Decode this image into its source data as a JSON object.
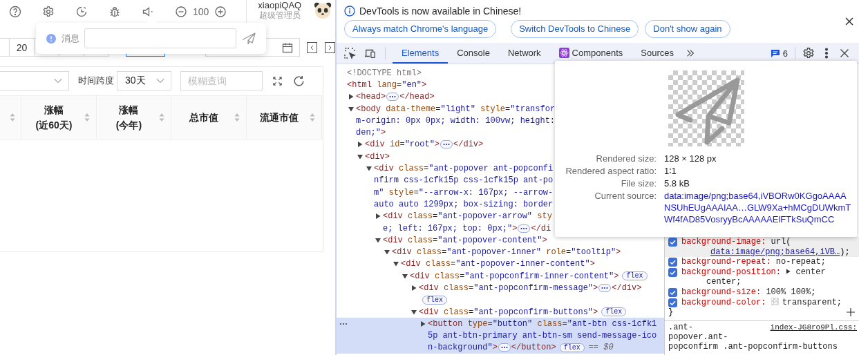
{
  "app": {
    "header": {
      "zoom": "100",
      "user_name": "xiaopiQAQ",
      "user_role": "超级管理员"
    },
    "message_popover": {
      "label": "消息"
    },
    "range_buttons": [
      {
        "selected": false
      },
      {
        "label": "20",
        "selected": false
      },
      {
        "selected": false
      },
      {
        "selected": false
      },
      {
        "selected": false
      },
      {
        "selected": true
      }
    ],
    "filters": {
      "span_label": "时间跨度",
      "span_value": "30天",
      "search_placeholder": "模糊查询"
    },
    "table": {
      "columns": [
        {
          "label": "涨幅\n(近60天)"
        },
        {
          "label": "涨幅\n(今年)"
        },
        {
          "label": "总市值"
        },
        {
          "label": "流通市值"
        }
      ]
    }
  },
  "devtools": {
    "infobar": {
      "message": "DevTools is now available in Chinese!",
      "buttons": [
        "Always match Chrome's language",
        "Switch DevTools to Chinese",
        "Don't show again"
      ]
    },
    "tabs": [
      {
        "label": "Elements",
        "selected": true,
        "kind": "plain"
      },
      {
        "label": "Console",
        "selected": false,
        "kind": "plain"
      },
      {
        "label": "Network",
        "selected": false,
        "kind": "plain"
      },
      {
        "label": "Components",
        "selected": false,
        "kind": "react"
      },
      {
        "label": "Sources",
        "selected": false,
        "kind": "plain"
      }
    ],
    "issues_count": "6",
    "elements": [
      {
        "kind": "doctype",
        "selected": false,
        "lines": [
          [
            "<!DOCTYPE html>"
          ]
        ]
      },
      {
        "kind": "element",
        "selected": false,
        "lines": [
          [
            "<html lang=\"en\">"
          ]
        ],
        "children": [
          {
            "kind": "element",
            "selected": false,
            "expanded": false,
            "lines": [
              [
                "<head>",
                {
                  "kind": "more"
                },
                "</head>"
              ]
            ]
          },
          {
            "kind": "element",
            "selected": false,
            "expanded": true,
            "lines": [
              [
                "<body data-theme=\"light\" style=\"transfor"
              ],
              [
                "m-origin: 0px 0px; width: 100vw; height:"
              ],
              [
                "den;\">"
              ]
            ],
            "children": [
              {
                "kind": "element",
                "selected": false,
                "expanded": false,
                "lines": [
                  [
                    "<div id=\"root\">",
                    {
                      "kind": "more"
                    },
                    "</div>"
                  ]
                ]
              },
              {
                "kind": "element",
                "selected": false,
                "expanded": true,
                "lines": [
                  [
                    "<div>"
                  ]
                ],
                "children": [
                  {
                    "kind": "element",
                    "selected": false,
                    "expanded": true,
                    "lines": [
                      [
                        "<div class=\"ant-popover ant-popconfi"
                      ],
                      [
                        "nfirm css-1cfk15p css-1cfk15p ant-po"
                      ],
                      [
                        "m\" style=\"--arrow-x: 167px; --arrow-"
                      ],
                      [
                        "auto auto 1299px; box-sizing: border"
                      ]
                    ],
                    "children": [
                      {
                        "kind": "element",
                        "selected": false,
                        "expanded": false,
                        "lines": [
                          [
                            "<div class=\"ant-popover-arrow\" sty"
                          ],
                          [
                            "e; left: 167px; top: 0px;\">",
                            {
                              "kind": "more"
                            },
                            "</di"
                          ]
                        ]
                      },
                      {
                        "kind": "element",
                        "selected": false,
                        "expanded": true,
                        "lines": [
                          [
                            "<div class=\"ant-popover-content\">"
                          ]
                        ],
                        "children": [
                          {
                            "kind": "element",
                            "selected": false,
                            "expanded": true,
                            "lines": [
                              [
                                "<div class=\"ant-popover-inner\" role=\"tooltip\">"
                              ]
                            ],
                            "children": [
                              {
                                "kind": "element",
                                "selected": false,
                                "expanded": true,
                                "lines": [
                                  [
                                    "<div class=\"ant-popover-inner-content\">"
                                  ]
                                ],
                                "children": [
                                  {
                                    "kind": "element",
                                    "selected": false,
                                    "expanded": true,
                                    "lines": [
                                      [
                                        "<div class=\"ant-popconfirm-inner-content\">",
                                        {
                                          "kind": "flex",
                                          "text": "flex"
                                        }
                                      ]
                                    ],
                                    "children": [
                                      {
                                        "kind": "element",
                                        "selected": false,
                                        "expanded": false,
                                        "lines": [
                                          [
                                            "<div class=\"ant-popconfirm-message\">",
                                            {
                                              "kind": "more"
                                            },
                                            "</div>"
                                          ],
                                          [
                                            {
                                              "kind": "flex",
                                              "text": "flex"
                                            }
                                          ]
                                        ]
                                      },
                                      {
                                        "kind": "element",
                                        "selected": false,
                                        "expanded": true,
                                        "lines": [
                                          [
                                            "<div class=\"ant-popconfirm-buttons\">",
                                            {
                                              "kind": "flex",
                                              "text": "flex"
                                            }
                                          ]
                                        ],
                                        "children": [
                                          {
                                            "kind": "element",
                                            "selected": true,
                                            "expanded": false,
                                            "lines": [
                                              [
                                                "<button type=\"button\" class=\"ant-btn css-1cfk1"
                                              ],
                                              [
                                                "5p ant-btn-primary ant-btn-sm send-message-ico"
                                              ],
                                              [
                                                "n-background\">",
                                                {
                                                  "kind": "more"
                                                },
                                                "</button>",
                                                {
                                                  "kind": "flex",
                                                  "text": "flex"
                                                },
                                                {
                                                  "kind": "ref",
                                                  "text": "== $0"
                                                }
                                              ]
                                            ]
                                          }
                                        ]
                                      }
                                    ]
                                  }
                                ]
                              }
                            ]
                          }
                        ]
                      }
                    ]
                  }
                ]
              }
            ]
          }
        ]
      }
    ],
    "image_tooltip": {
      "rows": [
        {
          "kind": "text",
          "label": "Rendered size:",
          "value": "128 × 128 px"
        },
        {
          "kind": "text",
          "label": "Rendered aspect ratio:",
          "value": "1∶1"
        },
        {
          "kind": "text",
          "label": "File size:",
          "value": "5.8 kB"
        },
        {
          "kind": "link",
          "label": "Current source:",
          "value": "data:image/png;base64,iVBORw0KGgoAAAANSUhEUgAAAIAA…GLW9Xa+hMCgDUWkmTWf4fAD85VosryyBcAAAAAElFTkSuQmCC"
        }
      ]
    },
    "styles": {
      "declarations": [
        {
          "kind": "url",
          "name": "background-image:",
          "value": "url(",
          "link": "data:image/png;base64,iVB…",
          "value_end": ");",
          "checked": true
        },
        {
          "kind": "plain",
          "name": "background-repeat:",
          "value": "no-repeat;",
          "checked": true
        },
        {
          "kind": "expandable",
          "name": "background-position:",
          "value": "center center;",
          "checked": true
        },
        {
          "kind": "plain",
          "name": "background-size:",
          "value": "100% 100%;",
          "checked": true
        },
        {
          "kind": "color",
          "name": "background-color:",
          "value": "transparent;",
          "checked": true
        }
      ],
      "close_brace": "}",
      "next_rule": {
        "selector_lines": [
          ".ant-",
          "popover.ant-",
          "popconfirm .ant-popconfirm-buttons"
        ],
        "source": "index-JG8ro9Pl.css:"
      }
    }
  }
}
